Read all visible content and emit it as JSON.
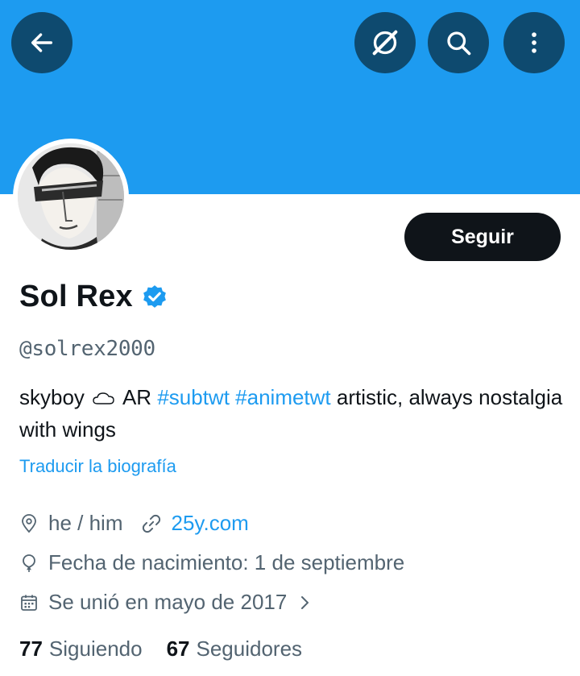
{
  "header": {
    "colors": {
      "banner": "#1d9bf0",
      "button_bg": "#0e4a6f"
    },
    "buttons": [
      {
        "icon": "arrow-left-icon",
        "purpose": "back"
      },
      {
        "icon": "grok-icon",
        "purpose": "grok"
      },
      {
        "icon": "search-icon",
        "purpose": "search"
      },
      {
        "icon": "more-vertical-icon",
        "purpose": "more"
      }
    ]
  },
  "profile": {
    "avatar_icon": "profile-avatar",
    "follow_label": "Seguir",
    "display_name": "Sol Rex",
    "verified_icon": "verified-badge-icon",
    "handle": "@solrex2000",
    "bio": {
      "part1": "skyboy",
      "emoji": "cloud-icon",
      "part2": "AR",
      "hashtag1": "#subtwt",
      "hashtag2": "#animetwt",
      "part3": "artistic, always nostalgia with wings"
    },
    "translate_label": "Traducir la biografía",
    "pronouns": "he / him",
    "website": "25y.com",
    "birthday": "Fecha de nacimiento: 1 de septiembre",
    "joined": "Se unió en mayo de 2017",
    "following_count": "77",
    "following_label": "Siguiendo",
    "followers_count": "67",
    "followers_label": "Seguidores"
  }
}
